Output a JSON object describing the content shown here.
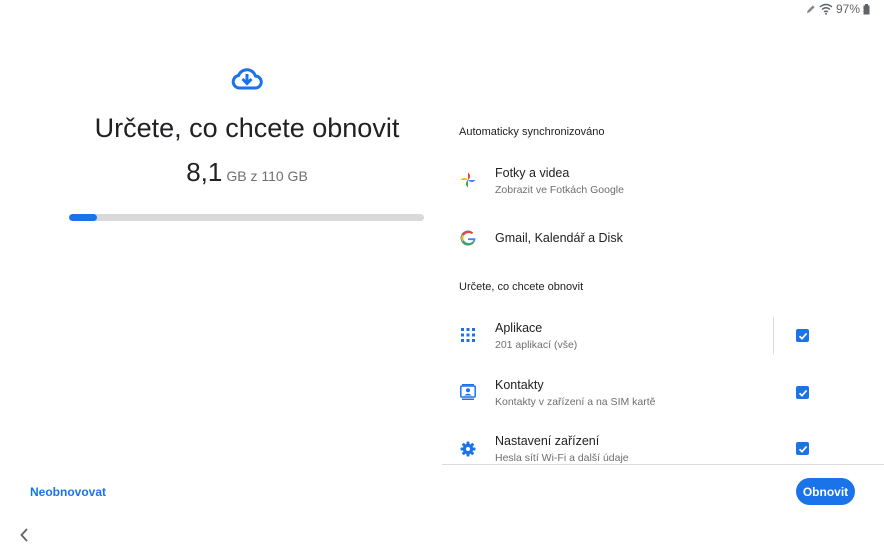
{
  "status_bar": {
    "battery": "97%",
    "icons": [
      "pen-icon",
      "wifi-icon",
      "battery-icon"
    ]
  },
  "left": {
    "icon": "cloud-download-icon",
    "title": "Určete, co chcete obnovit",
    "storage_used": "8,1",
    "storage_total": "GB z 110 GB",
    "progress_fraction": 0.08
  },
  "auto_sync": {
    "header": "Automaticky synchronizováno",
    "items": [
      {
        "icon": "google-photos-icon",
        "title": "Fotky a videa",
        "subtitle": "Zobrazit ve Fotkách Google"
      },
      {
        "icon": "google-icon",
        "title": "Gmail, Kalendář a Disk"
      }
    ]
  },
  "restore_choice": {
    "header": "Určete, co chcete obnovit",
    "items": [
      {
        "icon": "apps-grid-icon",
        "title": "Aplikace",
        "subtitle": "201 aplikací (vše)",
        "checked": true
      },
      {
        "icon": "contacts-icon",
        "title": "Kontakty",
        "subtitle": "Kontakty v zařízení a na SIM kartě",
        "checked": true
      },
      {
        "icon": "gear-icon",
        "title": "Nastavení zařízení",
        "subtitle": "Hesla sítí Wi-Fi a další údaje",
        "checked": true
      }
    ]
  },
  "buttons": {
    "skip": "Neobnovovat",
    "restore": "Obnovit"
  },
  "colors": {
    "accent": "#1a73e8",
    "track": "#d9d9d9",
    "text": "#202124",
    "secondary_text": "#6f6f6f"
  }
}
